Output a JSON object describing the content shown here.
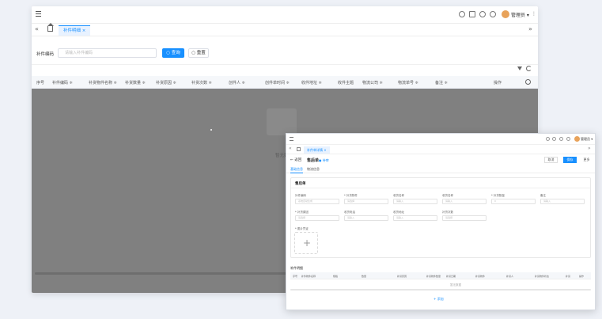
{
  "main": {
    "topbar": {
      "user": "管理员 ▾",
      "kebab": "⋮"
    },
    "tabs": {
      "active": "补件明细 ×",
      "collapse_left": "«",
      "collapse_right": "»"
    },
    "search": {
      "label": "补件编码",
      "placeholder": "请输入补件编码",
      "query_button": "○ 查询",
      "reset_button": "○ 重置"
    },
    "table_headers": [
      "序号",
      "补件编码 ≑",
      "补货物件名称 ≑",
      "补货数量 ≑",
      "补货原因 ≑",
      "补货次数 ≑",
      "创件人 ≑",
      "创件单时间 ≑",
      "收件地址 ≑",
      "收件主题",
      "物流公司 ≑",
      "物流单号 ≑",
      "备注 ≑",
      "操作"
    ],
    "empty_text": "暂无数据"
  },
  "detail": {
    "topbar": {
      "user": "管理员 ▾"
    },
    "tabs": {
      "active": "补件单详情 ×",
      "collapse_left": "«",
      "collapse_right": "»"
    },
    "header": {
      "back": "← 返回",
      "title": "售后单",
      "status": "● 待审",
      "btn_cancel": "取消",
      "btn_save": "保存",
      "btn_more": "更多"
    },
    "subtabs": [
      "基础信息",
      "物流信息"
    ],
    "card_title": "售后单",
    "fields": [
      {
        "label": "补件编码",
        "placeholder": "系统自动生成"
      },
      {
        "label": "* 补货物件",
        "placeholder": "请选择"
      },
      {
        "label": "收货名称",
        "placeholder": "请输入"
      },
      {
        "label": "收货名称",
        "placeholder": "请输入"
      },
      {
        "label": "* 补货数量",
        "placeholder": "0"
      },
      {
        "label": "备注",
        "placeholder": "请输入"
      },
      {
        "label": "* 补货原因",
        "placeholder": "请选择"
      },
      {
        "label": "收货电话",
        "placeholder": "请输入"
      },
      {
        "label": "收货地址",
        "placeholder": "请输入"
      },
      {
        "label": "补货次数",
        "placeholder": "请选择"
      }
    ],
    "upload_label": "* 图片凭证",
    "upload_plus": "+",
    "section2_title": "补件明细",
    "table2_headers": [
      "序号",
      "补件物件名称",
      "规格",
      "数量",
      "补货原因",
      "补货物件数量",
      "补货日期",
      "补货物件",
      "补货人",
      "补货物件状态",
      "补货",
      "操作"
    ],
    "no_data": "暂无数据",
    "add_button": "+ 添加"
  }
}
